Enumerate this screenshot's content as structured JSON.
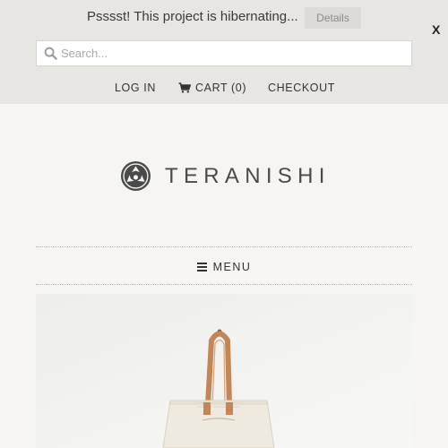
{
  "announcement": {
    "text": "Psssst! This project is hibernating...",
    "details_label": "Details",
    "close_label": "X"
  },
  "search": {
    "placeholder": "Search..."
  },
  "header_links": {
    "login": "LOG IN",
    "cart": "CART (0)",
    "checkout": "CHECKOUT"
  },
  "brand": {
    "name": "TERANISHI"
  },
  "menu": {
    "label": "MENU"
  },
  "hero": {
    "subject": "canvas tote bag with leather handle"
  },
  "colors": {
    "topbar_bg": "#e7e6e2",
    "page_bg": "#f6f5f2",
    "text": "#333333",
    "leather": "#c98b5a",
    "canvas": "#eee9df"
  }
}
